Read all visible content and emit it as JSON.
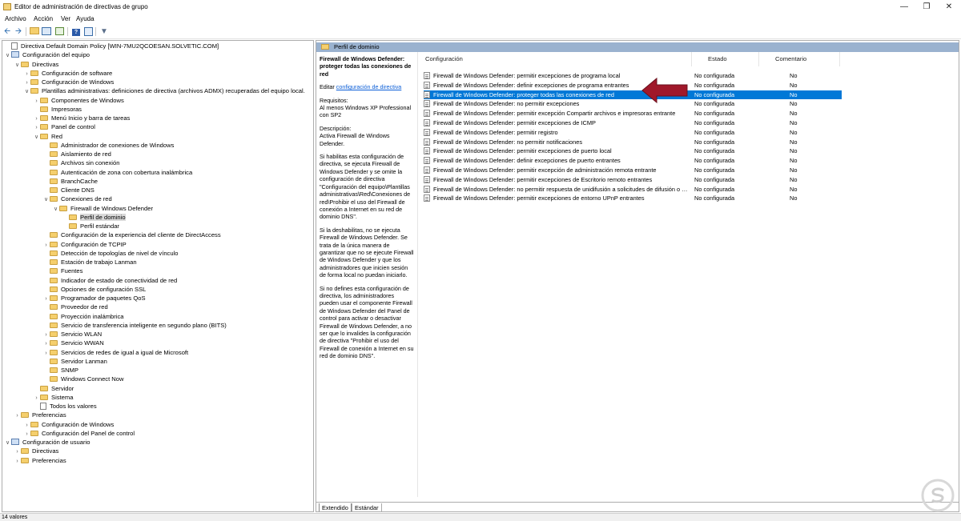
{
  "window": {
    "title": "Editor de administración de directivas de grupo"
  },
  "menu": [
    "Archivo",
    "Acción",
    "Ver",
    "Ayuda"
  ],
  "tree": [
    {
      "label": "Directiva Default Domain Policy [WIN-7MU2QCOESAN.SOLVETIC.COM]",
      "depth": 0,
      "icon": "document-icon",
      "exp": ""
    },
    {
      "label": "Configuración del equipo",
      "depth": 0,
      "icon": "computer-icon",
      "exp": "v"
    },
    {
      "label": "Directivas",
      "depth": 1,
      "icon": "folder-icon",
      "exp": "v"
    },
    {
      "label": "Configuración de software",
      "depth": 2,
      "icon": "folder-icon",
      "exp": ">"
    },
    {
      "label": "Configuración de Windows",
      "depth": 2,
      "icon": "folder-icon",
      "exp": ">"
    },
    {
      "label": "Plantillas administrativas: definiciones de directiva (archivos ADMX) recuperadas del equipo local.",
      "depth": 2,
      "icon": "folder-icon",
      "exp": "v"
    },
    {
      "label": "Componentes de Windows",
      "depth": 3,
      "icon": "folder-icon",
      "exp": ">"
    },
    {
      "label": "Impresoras",
      "depth": 3,
      "icon": "folder-icon",
      "exp": ""
    },
    {
      "label": "Menú Inicio y barra de tareas",
      "depth": 3,
      "icon": "folder-icon",
      "exp": ">"
    },
    {
      "label": "Panel de control",
      "depth": 3,
      "icon": "folder-icon",
      "exp": ">"
    },
    {
      "label": "Red",
      "depth": 3,
      "icon": "folder-icon",
      "exp": "v"
    },
    {
      "label": "Administrador de conexiones de Windows",
      "depth": 4,
      "icon": "folder-icon",
      "exp": ""
    },
    {
      "label": "Aislamiento de red",
      "depth": 4,
      "icon": "folder-icon",
      "exp": ""
    },
    {
      "label": "Archivos sin conexión",
      "depth": 4,
      "icon": "folder-icon",
      "exp": ""
    },
    {
      "label": "Autenticación de zona con cobertura inalámbrica",
      "depth": 4,
      "icon": "folder-icon",
      "exp": ""
    },
    {
      "label": "BranchCache",
      "depth": 4,
      "icon": "folder-icon",
      "exp": ""
    },
    {
      "label": "Cliente DNS",
      "depth": 4,
      "icon": "folder-icon",
      "exp": ""
    },
    {
      "label": "Conexiones de red",
      "depth": 4,
      "icon": "folder-icon",
      "exp": "v"
    },
    {
      "label": "Firewall de Windows Defender",
      "depth": 5,
      "icon": "folder-icon",
      "exp": "v"
    },
    {
      "label": "Perfil de dominio",
      "depth": 6,
      "icon": "folder-icon",
      "exp": "",
      "selected": true
    },
    {
      "label": "Perfil estándar",
      "depth": 6,
      "icon": "folder-icon",
      "exp": ""
    },
    {
      "label": "Configuración de la experiencia del cliente de DirectAccess",
      "depth": 4,
      "icon": "folder-icon",
      "exp": ""
    },
    {
      "label": "Configuración de TCPIP",
      "depth": 4,
      "icon": "folder-icon",
      "exp": ">"
    },
    {
      "label": "Detección de topologías de nivel de vínculo",
      "depth": 4,
      "icon": "folder-icon",
      "exp": ""
    },
    {
      "label": "Estación de trabajo Lanman",
      "depth": 4,
      "icon": "folder-icon",
      "exp": ""
    },
    {
      "label": "Fuentes",
      "depth": 4,
      "icon": "folder-icon",
      "exp": ""
    },
    {
      "label": "Indicador de estado de conectividad de red",
      "depth": 4,
      "icon": "folder-icon",
      "exp": ""
    },
    {
      "label": "Opciones de configuración SSL",
      "depth": 4,
      "icon": "folder-icon",
      "exp": ""
    },
    {
      "label": "Programador de paquetes QoS",
      "depth": 4,
      "icon": "folder-icon",
      "exp": ">"
    },
    {
      "label": "Proveedor de red",
      "depth": 4,
      "icon": "folder-icon",
      "exp": ""
    },
    {
      "label": "Proyección inalámbrica",
      "depth": 4,
      "icon": "folder-icon",
      "exp": ""
    },
    {
      "label": "Servicio de transferencia inteligente en segundo plano (BITS)",
      "depth": 4,
      "icon": "folder-icon",
      "exp": ""
    },
    {
      "label": "Servicio WLAN",
      "depth": 4,
      "icon": "folder-icon",
      "exp": ">"
    },
    {
      "label": "Servicio WWAN",
      "depth": 4,
      "icon": "folder-icon",
      "exp": ">"
    },
    {
      "label": "Servicios de redes de igual a igual de Microsoft",
      "depth": 4,
      "icon": "folder-icon",
      "exp": ">"
    },
    {
      "label": "Servidor Lanman",
      "depth": 4,
      "icon": "folder-icon",
      "exp": ""
    },
    {
      "label": "SNMP",
      "depth": 4,
      "icon": "folder-icon",
      "exp": ""
    },
    {
      "label": "Windows Connect Now",
      "depth": 4,
      "icon": "folder-icon",
      "exp": ""
    },
    {
      "label": "Servidor",
      "depth": 3,
      "icon": "folder-icon",
      "exp": ""
    },
    {
      "label": "Sistema",
      "depth": 3,
      "icon": "folder-icon",
      "exp": ">"
    },
    {
      "label": "Todos los valores",
      "depth": 3,
      "icon": "document-icon",
      "exp": ""
    },
    {
      "label": "Preferencias",
      "depth": 1,
      "icon": "folder-icon",
      "exp": ">"
    },
    {
      "label": "Configuración de Windows",
      "depth": 2,
      "icon": "folder-icon",
      "exp": ">"
    },
    {
      "label": "Configuración del Panel de control",
      "depth": 2,
      "icon": "folder-icon",
      "exp": ">"
    },
    {
      "label": "Configuración de usuario",
      "depth": 0,
      "icon": "computer-icon",
      "exp": "v"
    },
    {
      "label": "Directivas",
      "depth": 1,
      "icon": "folder-icon",
      "exp": ">"
    },
    {
      "label": "Preferencias",
      "depth": 1,
      "icon": "folder-icon",
      "exp": ">"
    }
  ],
  "right": {
    "header": "Perfil de dominio",
    "desc_title": "Firewall de Windows Defender: proteger todas las conexiones de red",
    "edit_prefix": "Editar",
    "edit_link": "configuración de directiva",
    "requirements": "Requisitos:\nAl menos Windows XP Professional con SP2",
    "description": "Descripción:\nActiva Firewall de Windows Defender.",
    "p1": "Si habilitas esta configuración de directiva, se ejecuta Firewall de Windows Defender y se omite la configuración de directiva \"Configuración del equipo\\Plantillas administrativas\\Red\\Conexiones de red\\Prohibir el uso del Firewall de conexión a Internet en su red de dominio DNS\".",
    "p2": "Si la deshabilitas, no se ejecuta Firewall de Windows Defender. Se trata de la única manera de garantizar que no se ejecute Firewall de Windows Defender y que los administradores que inicien sesión de forma local no puedan iniciarlo.",
    "p3": "Si no defines esta configuración de directiva, los administradores pueden usar el componente Firewall de Windows Defender del Panel de control para activar o desactivar Firewall de Windows Defender, a no ser que lo invalides la configuración de directiva \"Prohibir el uso del Firewall de conexión a Internet en su red de dominio DNS\"."
  },
  "columns": {
    "c1": "Configuración",
    "c2": "Estado",
    "c3": "Comentario"
  },
  "rows": [
    {
      "name": "Firewall de Windows Defender: permitir excepciones de programa local",
      "state": "No configurada",
      "comment": "No"
    },
    {
      "name": "Firewall de Windows Defender: definir excepciones de programa entrantes",
      "state": "No configurada",
      "comment": "No"
    },
    {
      "name": "Firewall de Windows Defender: proteger todas las conexiones de red",
      "state": "No configurada",
      "comment": "No",
      "selected": true
    },
    {
      "name": "Firewall de Windows Defender: no permitir excepciones",
      "state": "No configurada",
      "comment": "No"
    },
    {
      "name": "Firewall de Windows Defender: permitir excepción Compartir archivos e impresoras entrante",
      "state": "No configurada",
      "comment": "No"
    },
    {
      "name": "Firewall de Windows Defender: permitir excepciones de ICMP",
      "state": "No configurada",
      "comment": "No"
    },
    {
      "name": "Firewall de Windows Defender: permitir registro",
      "state": "No configurada",
      "comment": "No"
    },
    {
      "name": "Firewall de Windows Defender: no permitir notificaciones",
      "state": "No configurada",
      "comment": "No"
    },
    {
      "name": "Firewall de Windows Defender: permitir excepciones de puerto local",
      "state": "No configurada",
      "comment": "No"
    },
    {
      "name": "Firewall de Windows Defender: definir excepciones de puerto entrantes",
      "state": "No configurada",
      "comment": "No"
    },
    {
      "name": "Firewall de Windows Defender: permitir excepción de administración remota entrante",
      "state": "No configurada",
      "comment": "No"
    },
    {
      "name": "Firewall de Windows Defender: permitir excepciones de Escritorio remoto entrantes",
      "state": "No configurada",
      "comment": "No"
    },
    {
      "name": "Firewall de Windows Defender: no permitir respuesta de unidifusión a solicitudes de difusión o multidifusión",
      "state": "No configurada",
      "comment": "No"
    },
    {
      "name": "Firewall de Windows Defender: permitir excepciones de entorno UPnP entrantes",
      "state": "No configurada",
      "comment": "No"
    }
  ],
  "tabs": [
    "Extendido",
    "Estándar"
  ],
  "status": "14 valores",
  "colors": {
    "selection": "#0078d7",
    "header": "#9ab2cf",
    "arrow": "#a0182a"
  }
}
